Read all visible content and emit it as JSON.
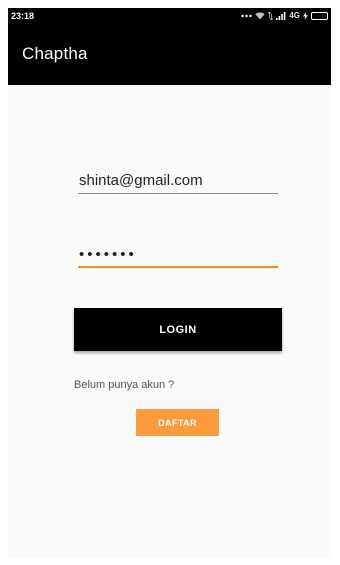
{
  "status_bar": {
    "time": "23:18",
    "network": "4G"
  },
  "app_bar": {
    "title": "Chaptha"
  },
  "login_form": {
    "email_value": "shinta@gmail.com",
    "password_value": "•••••••",
    "login_label": "LOGIN",
    "register_prompt": "Belum punya akun ?",
    "register_label": "DAFTAR"
  },
  "colors": {
    "app_bar": "#000000",
    "accent": "#f58a1f",
    "register_button": "#fb9b3d",
    "login_button": "#000000"
  },
  "icons": [
    "more-dots-icon",
    "wifi-icon",
    "data-arrows-icon",
    "signal-icon",
    "charging-icon",
    "battery-icon"
  ]
}
